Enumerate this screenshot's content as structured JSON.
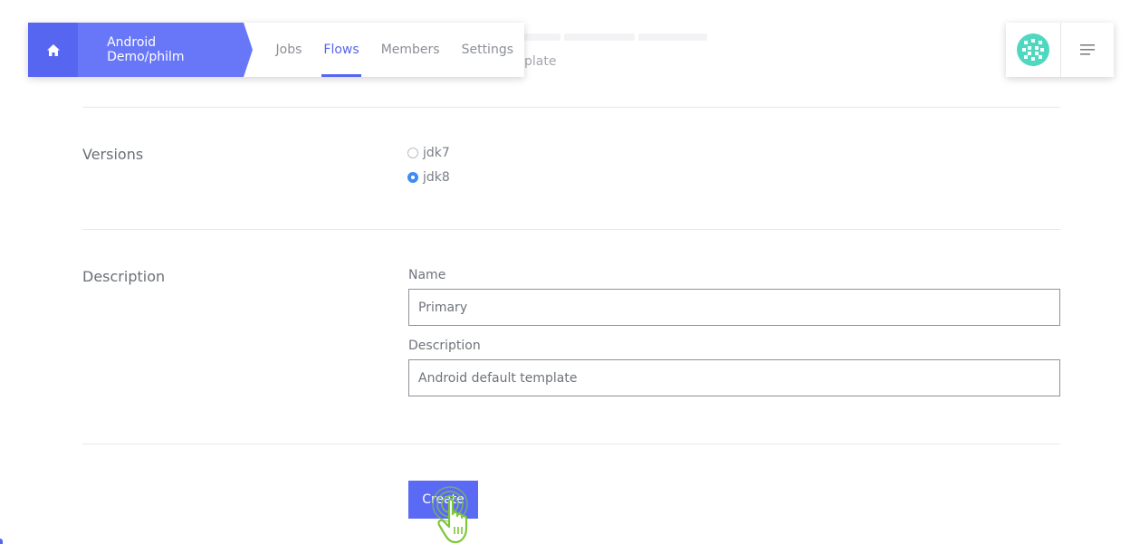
{
  "background_ghost": {
    "text": "plate"
  },
  "nav": {
    "home_icon": "home-icon",
    "breadcrumb": "Android Demo/philm",
    "tabs": [
      {
        "label": "Jobs",
        "active": false
      },
      {
        "label": "Flows",
        "active": true
      },
      {
        "label": "Members",
        "active": false
      },
      {
        "label": "Settings",
        "active": false
      }
    ],
    "accent_color": "#5666f0"
  },
  "header_right": {
    "avatar_icon": "identicon-avatar",
    "menu_icon": "hamburger-menu-icon"
  },
  "versions": {
    "label": "Versions",
    "options": [
      {
        "label": "jdk7",
        "checked": false
      },
      {
        "label": "jdk8",
        "checked": true
      }
    ]
  },
  "description": {
    "label": "Description",
    "name_label": "Name",
    "name_value": "Primary",
    "description_label": "Description",
    "description_value": "Android default template"
  },
  "actions": {
    "create_label": "Create"
  }
}
